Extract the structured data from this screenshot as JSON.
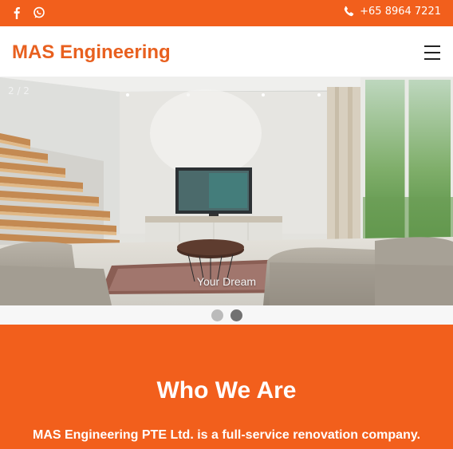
{
  "topbar": {
    "social_icons": [
      "facebook-icon",
      "whatsapp-icon"
    ],
    "phone_icon": "phone-icon",
    "phone": "+65 8964 7221"
  },
  "navbar": {
    "brand": "MAS Engineering",
    "menu_icon": "hamburger-menu-icon"
  },
  "slideshow": {
    "counter": "2 / 2",
    "caption": "Your Dream",
    "slide_count": 2,
    "active_slide": 2
  },
  "about": {
    "title": "Who We Are",
    "text": "MAS Engineering PTE Ltd. is a full-service renovation company. From"
  },
  "colors": {
    "brand_orange": "#f25f1c",
    "brand_text": "#e8601f",
    "dot_inactive": "#bbbbbb",
    "dot_active": "#717171"
  }
}
